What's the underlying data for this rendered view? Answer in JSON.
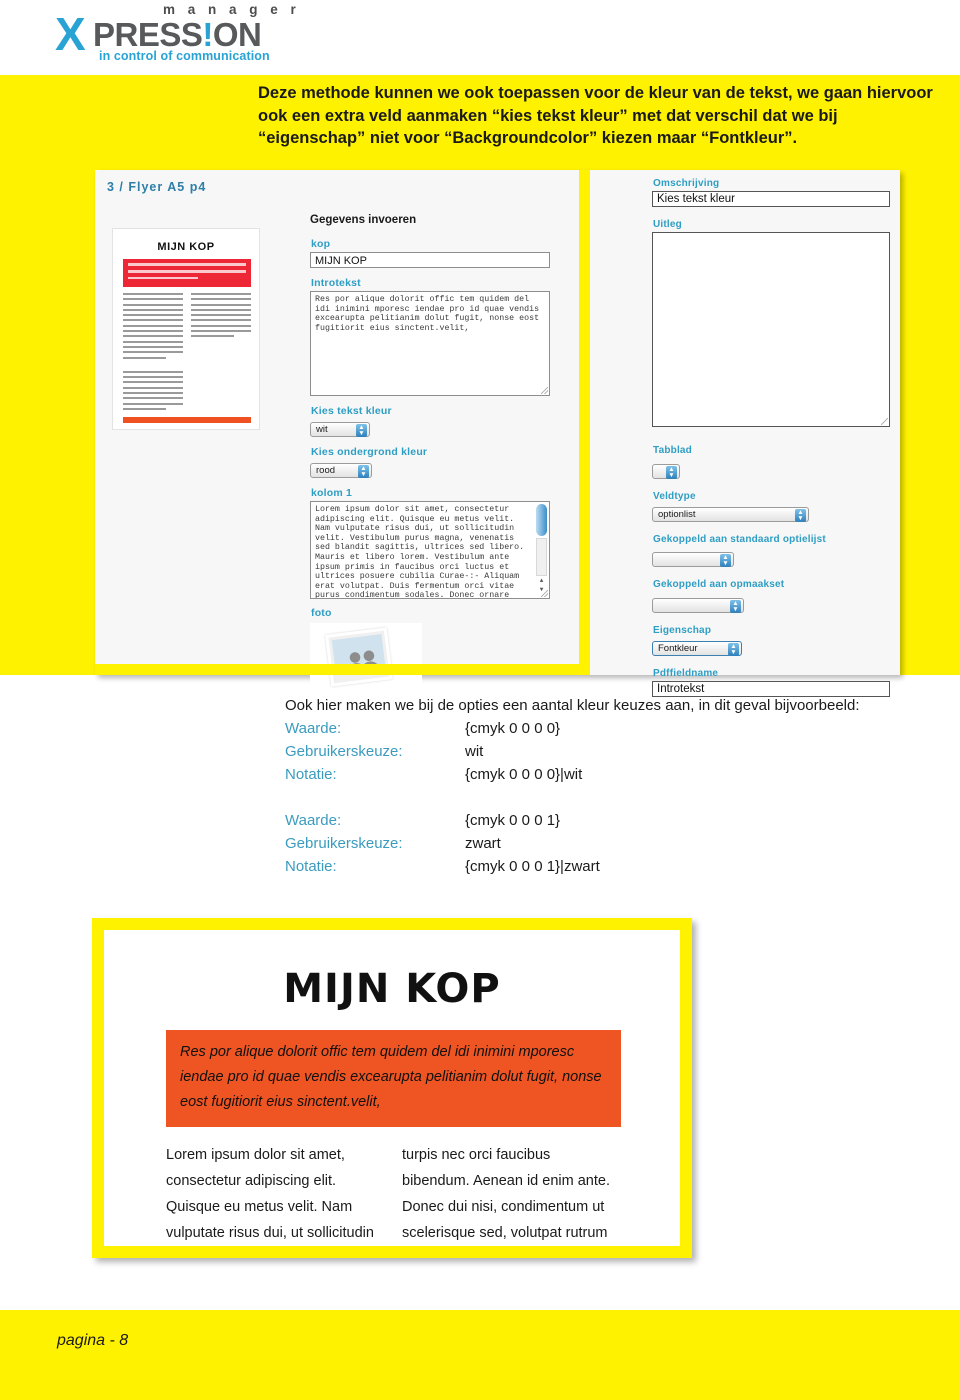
{
  "logo": {
    "manager": "m a n a g e r",
    "x": "X",
    "pression_pre": "PRESS",
    "pression_bang": "!",
    "pression_post": "ON",
    "tagline": "in control of communication"
  },
  "header": {
    "paragraph": "Deze methode kunnen we ook toepassen voor de kleur van de tekst, we gaan hiervoor ook een extra veld aanmaken “kies tekst kleur” met dat verschil dat we bij “eigenschap” niet voor “Backgroundcolor” kiezen maar “Fontkleur”."
  },
  "screenshot": {
    "title": "3 / Flyer A5 p4",
    "thumbnail": {
      "heading": "MIJN KOP"
    },
    "form": {
      "section_title": "Gegevens invoeren",
      "kop_label": "kop",
      "kop_value": "MIJN KOP",
      "introtekst_label": "Introtekst",
      "introtekst_value": "Res por alique dolorit offic tem quidem del idi inimini mporesc iendae pro id quae vendis excearupta pelitianim dolut fugit, nonse eost fugitiorit eius sinctent.velit,",
      "tekstkleur_label": "Kies tekst kleur",
      "tekstkleur_value": "wit",
      "ondergrond_label": "Kies ondergrond kleur",
      "ondergrond_value": "rood",
      "kolom1_label": "kolom 1",
      "kolom1_value": "Lorem ipsum dolor sit amet, consectetur adipiscing elit. Quisque eu metus velit. Nam vulputate risus dui, ut sollicitudin velit. Vestibulum purus magna, venenatis sed blandit sagittis, ultrices sed libero. Mauris et libero lorem. Vestibulum ante ipsum primis in faucibus orci luctus et ultrices posuere cubilia Curae-:- Aliquam erat volutpat. Duis fermentum orci vitae purus condimentum sodales. Donec ornare",
      "foto_label": "foto"
    },
    "properties": {
      "omschrijving_label": "Omschrijving",
      "omschrijving_value": "Kies tekst kleur",
      "uitleg_label": "Uitleg",
      "uitleg_value": "",
      "tabblad_label": "Tabblad",
      "tabblad_value": "",
      "veldtype_label": "Veldtype",
      "veldtype_value": "optionlist",
      "optielijst_label": "Gekoppeld aan standaard optielijst",
      "optielijst_value": "",
      "opmaakset_label": "Gekoppeld aan opmaakset",
      "opmaakset_value": "",
      "eigenschap_label": "Eigenschap",
      "eigenschap_value": "Fontkleur",
      "pdffieldname_label": "Pdffieldname",
      "pdffieldname_value": "Introtekst"
    }
  },
  "explanation": {
    "lead": "Ook hier maken we bij de opties een aantal kleur keuzes aan, in dit geval bijvoorbeeld:",
    "block1": [
      {
        "key": "Waarde:",
        "value": "{cmyk 0 0 0 0}"
      },
      {
        "key": "Gebruikerskeuze:",
        "value": "wit"
      },
      {
        "key": "Notatie:",
        "value": "{cmyk 0 0 0 0}|wit"
      }
    ],
    "block2": [
      {
        "key": "Waarde:",
        "value": "{cmyk 0 0 0 1}"
      },
      {
        "key": "Gebruikerskeuze:",
        "value": "zwart"
      },
      {
        "key": "Notatie:",
        "value": "{cmyk 0 0 0 1}|zwart"
      }
    ]
  },
  "preview": {
    "heading": "MIJN KOP",
    "intro": "Res por alique dolorit offic tem quidem del idi inimini mporesc iendae pro id quae vendis excearupta pelitianim dolut fugit, nonse eost fugitiorit eius sinctent.velit,",
    "column_left": "Lorem ipsum dolor sit amet, consectetur adipiscing elit. Quisque eu metus velit. Nam vulputate risus dui, ut sollicitudin velit.Vestibulum",
    "column_right": "turpis nec orci faucibus bibendum. Aenean id enim ante. Donec dui nisi, condimentum ut scelerisque sed, volutpat rutrum neque."
  },
  "footer": {
    "page": "pagina - 8"
  },
  "colors": {
    "yellow": "#fff200",
    "brand_blue": "#29a3d4",
    "label_blue": "#2e9ec4",
    "text_blue": "#3a9bbf",
    "orange": "#ef5423",
    "red": "#ee2737",
    "gray_text": "#58595b"
  }
}
